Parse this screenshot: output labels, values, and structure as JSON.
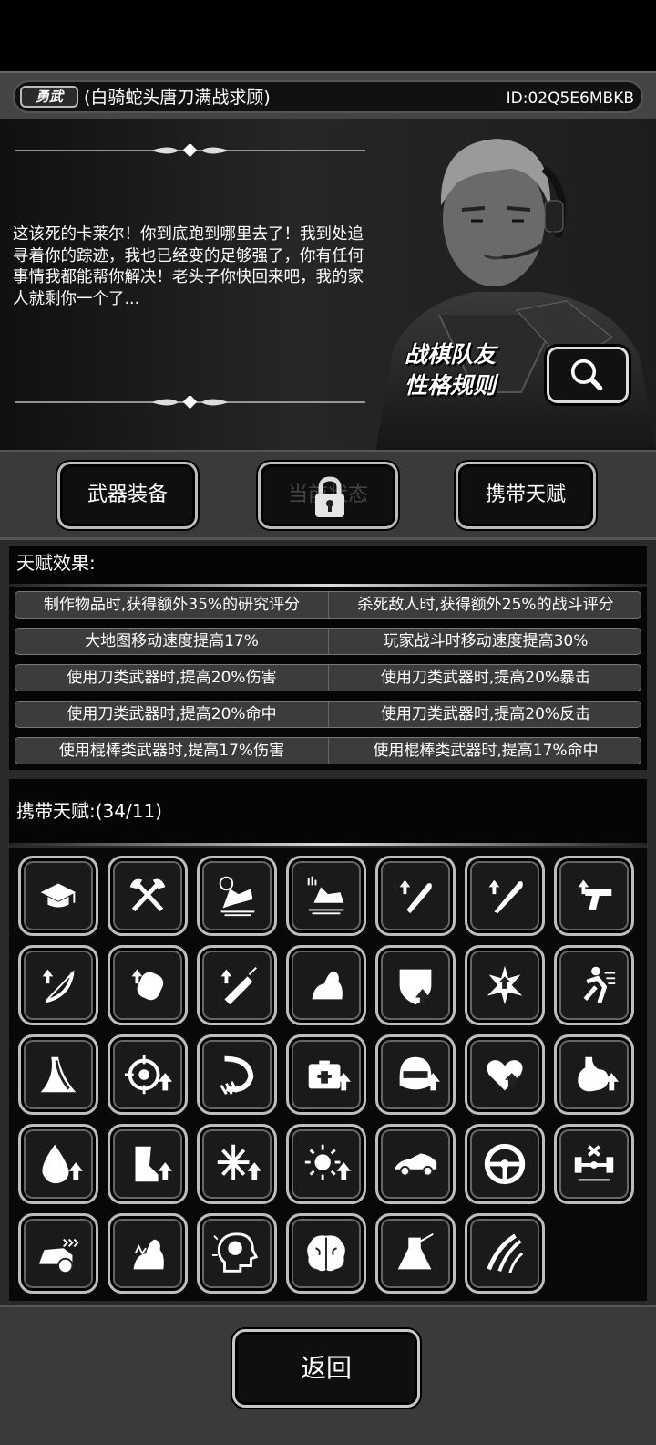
{
  "header": {
    "badge": "勇武",
    "character_name": "(白骑蛇头唐刀满战求顾)",
    "id_text": "ID:02Q5E6MBKB"
  },
  "story": {
    "text": "这该死的卡莱尔！你到底跑到哪里去了！我到处追寻着你的踪迹，我也已经变的足够强了，你有任何事情我都能帮你解决！老头子你快回来吧，我的家人就剩你一个了...",
    "rules_line1": "战棋队友",
    "rules_line2": "性格规则"
  },
  "tabs": {
    "weapons": "武器装备",
    "locked": "当前状态",
    "talents": "携带天赋"
  },
  "effects": {
    "title": "天赋效果:",
    "rows": [
      [
        "制作物品时,获得额外35%的研究评分",
        "杀死敌人时,获得额外25%的战斗评分"
      ],
      [
        "大地图移动速度提高17%",
        "玩家战斗时移动速度提高30%"
      ],
      [
        "使用刀类武器时,提高20%伤害",
        "使用刀类武器时,提高20%暴击"
      ],
      [
        "使用刀类武器时,提高20%命中",
        "使用刀类武器时,提高20%反击"
      ],
      [
        "使用棍棒类武器时,提高17%伤害",
        "使用棍棒类武器时,提高17%命中"
      ]
    ]
  },
  "carried": {
    "title": "携带天赋:(34/11)",
    "icons": [
      "graduation-cap-icon",
      "crossed-axes-icon",
      "clock-speed-icon",
      "foot-speed-icon",
      "machete-up-icon",
      "bat-up-icon",
      "pistol-up-icon",
      "bow-up-icon",
      "glove-up-icon",
      "syringe-up-icon",
      "arm-strength-icon",
      "shield-up-icon",
      "crit-burst-icon",
      "dodge-run-icon",
      "road-icon",
      "target-up-icon",
      "hook-claw-icon",
      "medkit-up-icon",
      "helmet-up-icon",
      "heart-up-icon",
      "stomach-up-icon",
      "drop-up-icon",
      "leg-up-icon",
      "snowflake-up-icon",
      "sun-up-icon",
      "sports-car-icon",
      "steering-wheel-icon",
      "axle-tools-icon",
      "car-speed-icon",
      "arm-fire-icon",
      "head-brain-icon",
      "brain-icon",
      "flask-icon",
      "scratch-marks-icon"
    ]
  },
  "bottom": {
    "back_label": "返回"
  }
}
